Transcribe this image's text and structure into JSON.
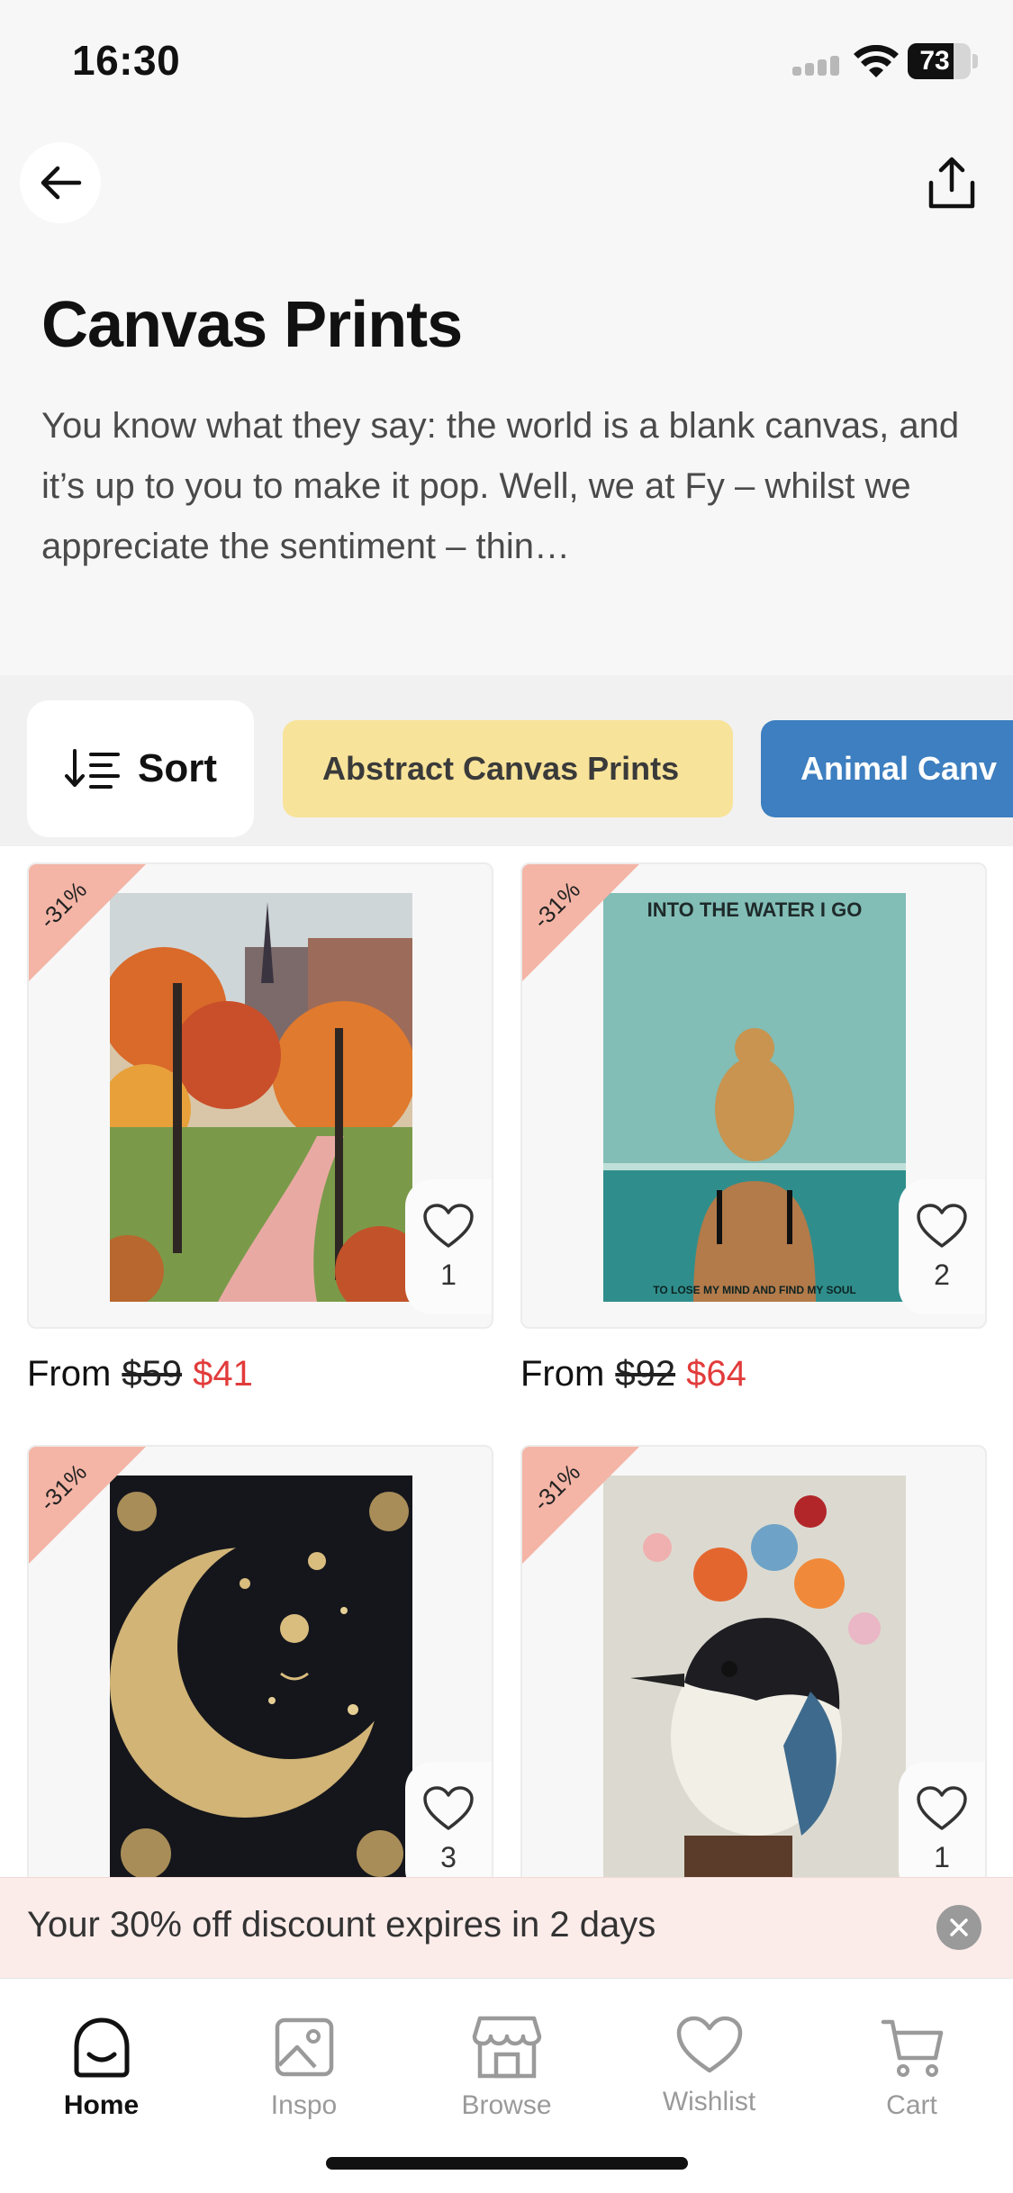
{
  "status_bar": {
    "time": "16:30",
    "battery": "73",
    "battery_level": 0.73
  },
  "header": {
    "title": "Canvas Prints",
    "description": "You know what they say: the world is a blank canvas, and it’s up to you to make it pop. Well, we at Fy – whilst we appreciate the sentiment – thin…"
  },
  "filters": {
    "sort_label": "Sort",
    "chips": [
      "Abstract Canvas Prints",
      "Animal Canv"
    ]
  },
  "products": [
    {
      "badge": "-31%",
      "price_prefix": "From",
      "old_price": "$59",
      "new_price": "$41",
      "wishlist_count": "1",
      "art": "autumn-park-painting"
    },
    {
      "badge": "-31%",
      "price_prefix": "From",
      "old_price": "$92",
      "new_price": "$64",
      "wishlist_count": "2",
      "art": "swimmer-poster",
      "art_top_text": "INTO THE WATER I GO",
      "art_bottom_text": "TO LOSE MY MIND AND FIND MY SOUL"
    },
    {
      "badge": "-31%",
      "wishlist_count": "3",
      "art": "golden-moon-illustration"
    },
    {
      "badge": "-31%",
      "wishlist_count": "1",
      "art": "bird-with-flowers-painting"
    }
  ],
  "discount_banner": {
    "text": "Your 30% off discount expires in 2 days"
  },
  "tab_bar": {
    "tabs": [
      {
        "label": "Home",
        "icon": "home-icon",
        "active": true
      },
      {
        "label": "Inspo",
        "icon": "image-icon",
        "active": false
      },
      {
        "label": "Browse",
        "icon": "store-icon",
        "active": false
      },
      {
        "label": "Wishlist",
        "icon": "heart-icon",
        "active": false
      },
      {
        "label": "Cart",
        "icon": "cart-icon",
        "active": false
      }
    ]
  },
  "colors": {
    "accent_sale": "#e23b3b",
    "chip_yellow": "#f8e39a",
    "chip_blue": "#3d7fc0",
    "badge": "#f4b5a6",
    "banner_bg": "#fbecea"
  }
}
